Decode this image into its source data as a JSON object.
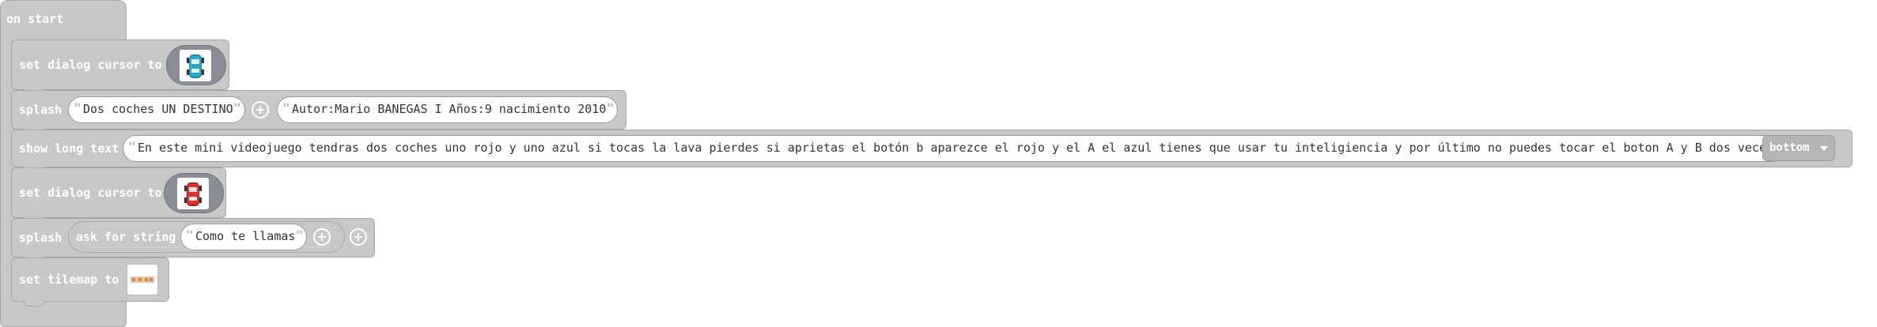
{
  "on_start": {
    "label": "on start"
  },
  "blocks": {
    "cursor1": {
      "label": "set dialog cursor to",
      "image": "blue-car-sprite"
    },
    "splash1": {
      "label": "splash",
      "text1": "Dos coches UN DESTINO",
      "text2": "Autor:Mario BANEGAS I Años:9 nacimiento 2010"
    },
    "long_text": {
      "label": "show long text",
      "text": "En este mini videojuego  tendras dos coches uno rojo y uno azul si tocas la lava pierdes si aprietas el botón b aparezce el rojo y el A el azul tienes que usar tu inteligiencia y por último no puedes tocar el boton A y B dos veces",
      "position": "bottom"
    },
    "cursor2": {
      "label": "set dialog cursor to",
      "image": "red-car-sprite"
    },
    "splash2": {
      "label": "splash",
      "ask_label": "ask for string",
      "ask_text": "Como te llamas"
    },
    "tilemap": {
      "label": "set tilemap to",
      "image": "tilemap-thumbnail"
    }
  },
  "colors": {
    "block": "#c8c8c8",
    "block_border": "#a8a8a8",
    "image_pill": "#8c8c96",
    "blue_car": "#2aa9c4",
    "red_car": "#e03030"
  }
}
